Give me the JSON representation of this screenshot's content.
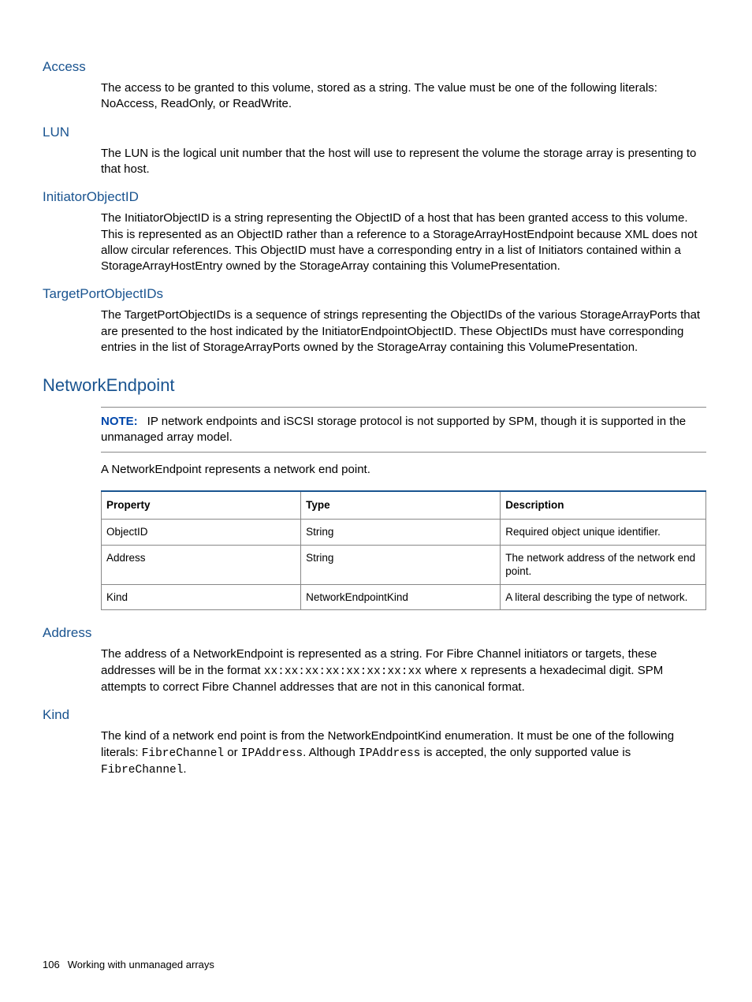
{
  "sections": {
    "access": {
      "title": "Access",
      "body": "The access to be granted to this volume, stored as a string. The value must be one of the following literals: NoAccess, ReadOnly, or ReadWrite."
    },
    "lun": {
      "title": "LUN",
      "body": "The LUN is the logical unit number that the host will use to represent the volume the storage array is presenting to that host."
    },
    "initiator": {
      "title": "InitiatorObjectID",
      "body": "The InitiatorObjectID is a string representing the ObjectID of a host that has been granted access to this volume. This is represented as an ObjectID rather than a reference to a StorageArrayHostEndpoint because XML does not allow circular references. This ObjectID must have a corresponding entry in a list of Initiators contained within a StorageArrayHostEntry owned by the StorageArray containing this VolumePresentation."
    },
    "targetport": {
      "title": "TargetPortObjectIDs",
      "body": "The TargetPortObjectIDs is a sequence of strings representing the ObjectIDs of the various StorageArrayPorts that are presented to the host indicated by the InitiatorEndpointObjectID. These ObjectIDs must have corresponding entries in the list of StorageArrayPorts owned by the StorageArray containing this VolumePresentation."
    },
    "networkendpoint": {
      "title": "NetworkEndpoint",
      "note_label": "NOTE:",
      "note_body": "IP network endpoints and iSCSI storage protocol is not supported by SPM, though it is supported in the unmanaged array model.",
      "intro": "A NetworkEndpoint represents a network end point."
    },
    "address": {
      "title": "Address",
      "body_pre": "The address of a NetworkEndpoint is represented as a string. For Fibre Channel initiators or targets, these addresses will be in the format ",
      "code1": "xx:xx:xx:xx:xx:xx:xx:xx",
      "body_mid": " where ",
      "code2": "x",
      "body_post": " represents a hexadecimal digit. SPM attempts to correct Fibre Channel addresses that are not in this canonical format."
    },
    "kind": {
      "title": "Kind",
      "body_pre": "The kind of a network end point is from the NetworkEndpointKind enumeration. It must be one of the following literals: ",
      "code1": "FibreChannel",
      "body_mid1": " or ",
      "code2": "IPAddress",
      "body_mid2": ". Although ",
      "code3": "IPAddress",
      "body_mid3": " is accepted, the only supported value is ",
      "code4": "FibreChannel",
      "body_end": "."
    }
  },
  "table": {
    "headers": {
      "c1": "Property",
      "c2": "Type",
      "c3": "Description"
    },
    "rows": [
      {
        "c1": "ObjectID",
        "c2": "String",
        "c3": "Required object unique identifier."
      },
      {
        "c1": "Address",
        "c2": "String",
        "c3": "The network address of the network end point."
      },
      {
        "c1": "Kind",
        "c2": "NetworkEndpointKind",
        "c3": "A literal describing the type of network."
      }
    ]
  },
  "footer": {
    "page": "106",
    "chapter": "Working with unmanaged arrays"
  }
}
